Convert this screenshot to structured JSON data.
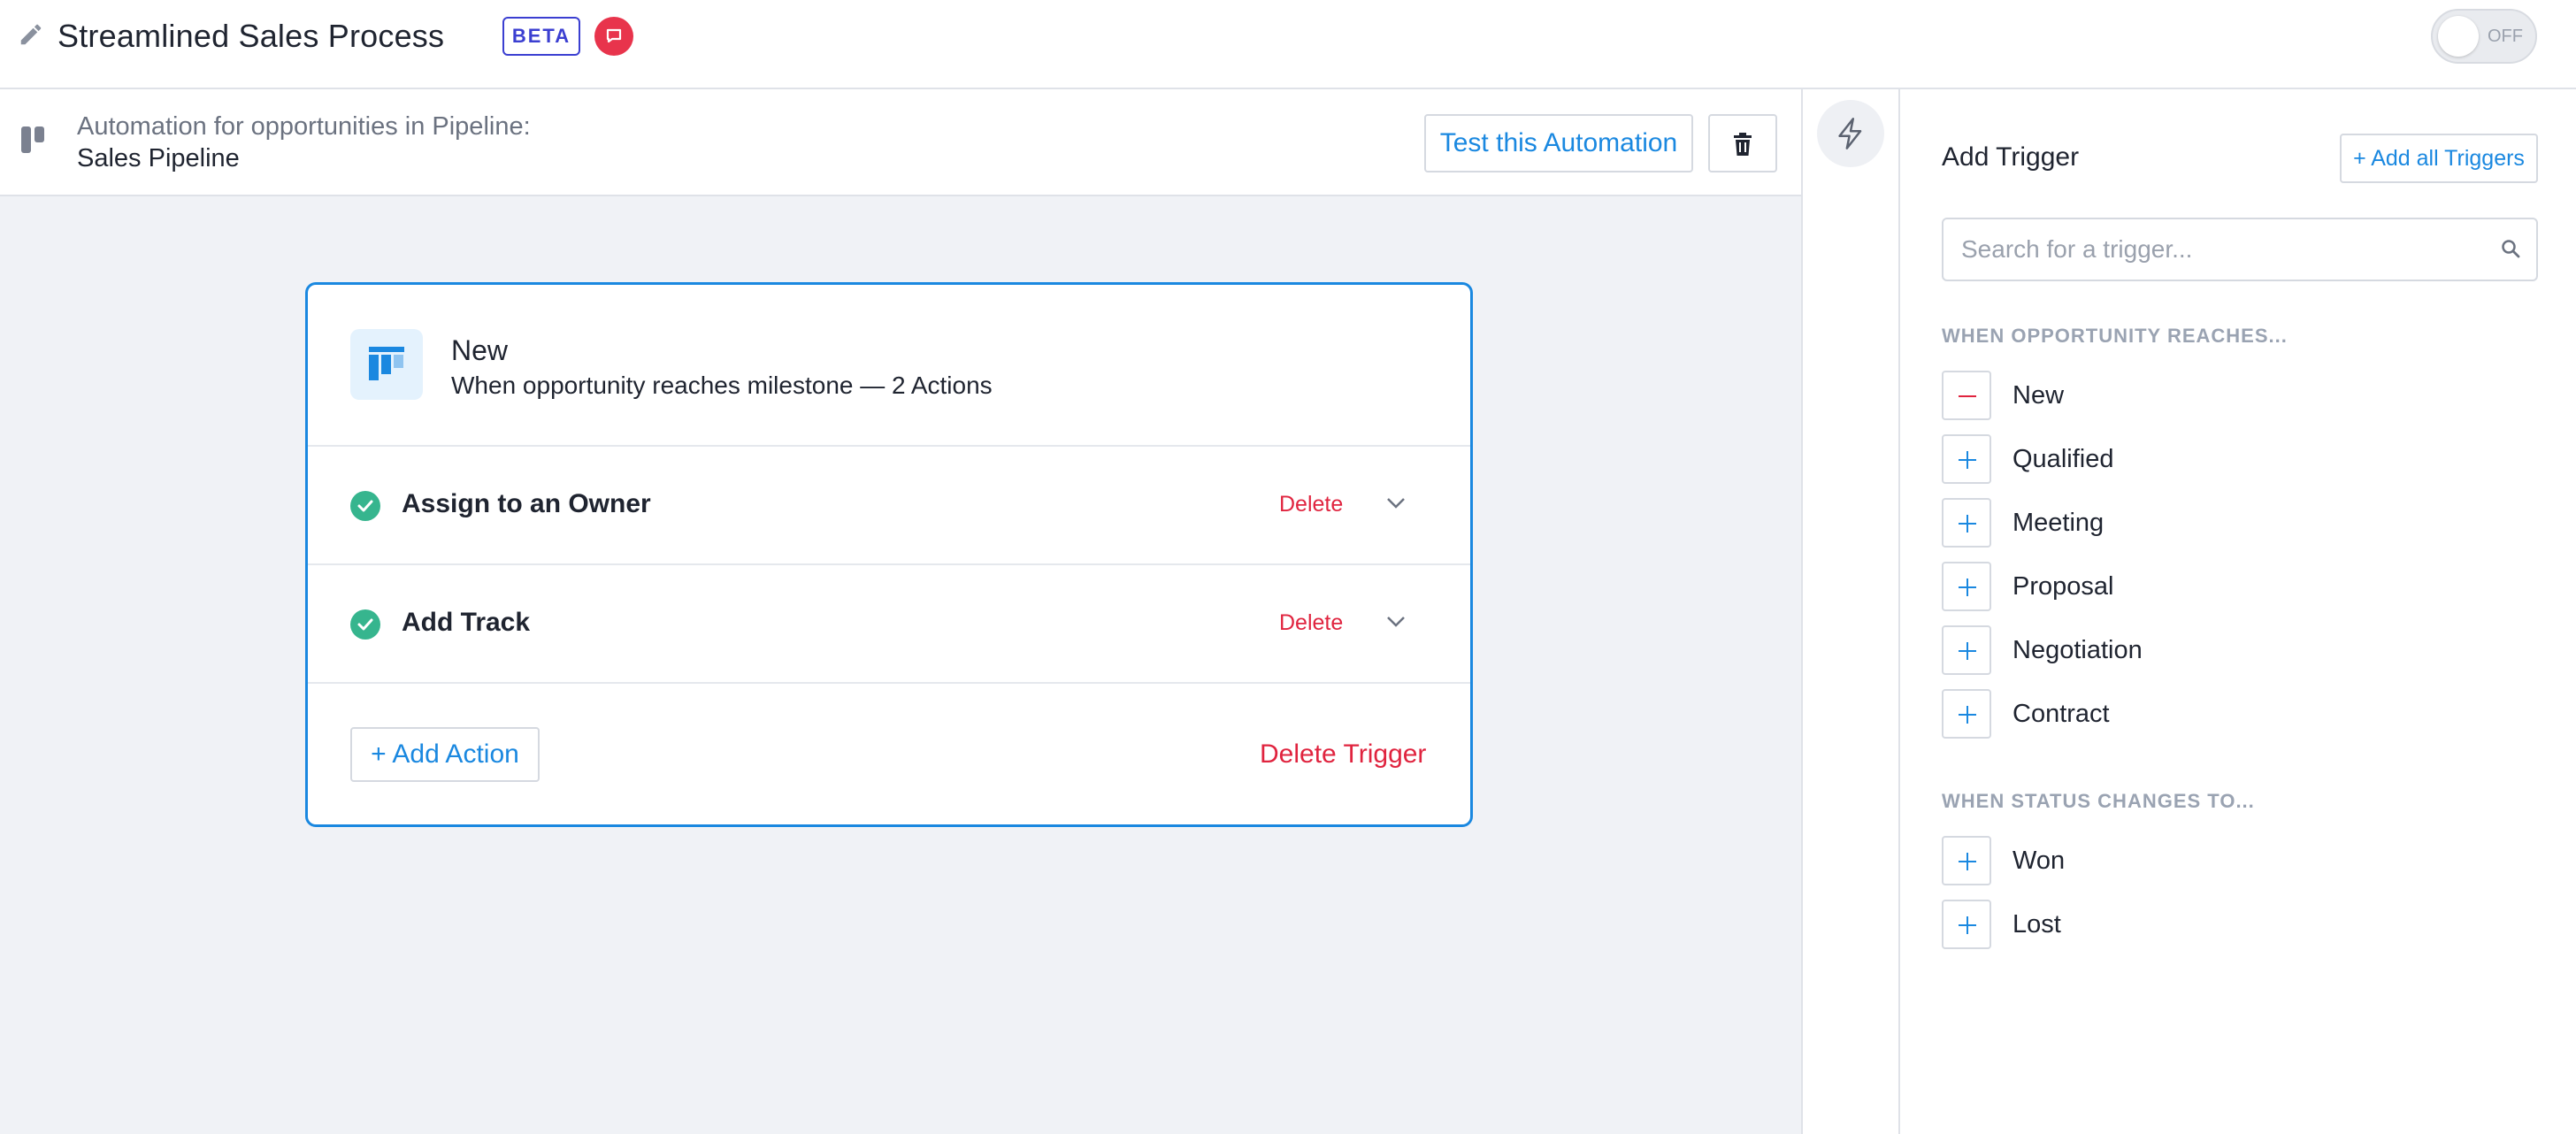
{
  "header": {
    "title": "Streamlined Sales Process",
    "beta_badge": "BETA",
    "toggle_state": "OFF"
  },
  "automation": {
    "context_label": "Automation for opportunities in Pipeline:",
    "pipeline_name": "Sales Pipeline",
    "test_button": "Test this Automation"
  },
  "card": {
    "title": "New",
    "subtitle": "When opportunity reaches milestone — 2 Actions",
    "actions": [
      {
        "label": "Assign to an Owner",
        "delete_label": "Delete"
      },
      {
        "label": "Add Track",
        "delete_label": "Delete"
      }
    ],
    "add_action": "+ Add Action",
    "delete_trigger": "Delete Trigger"
  },
  "panel": {
    "title": "Add Trigger",
    "add_all": "+ Add all Triggers",
    "search_placeholder": "Search for a trigger...",
    "sections": [
      {
        "label": "WHEN OPPORTUNITY REACHES...",
        "items": [
          {
            "label": "New",
            "state": "added"
          },
          {
            "label": "Qualified",
            "state": "available"
          },
          {
            "label": "Meeting",
            "state": "available"
          },
          {
            "label": "Proposal",
            "state": "available"
          },
          {
            "label": "Negotiation",
            "state": "available"
          },
          {
            "label": "Contract",
            "state": "available"
          }
        ]
      },
      {
        "label": "WHEN STATUS CHANGES TO...",
        "items": [
          {
            "label": "Won",
            "state": "available"
          },
          {
            "label": "Lost",
            "state": "available"
          }
        ]
      }
    ]
  },
  "colors": {
    "accent": "#1a88e0",
    "danger": "#e0243f",
    "success": "#36b58e",
    "beta": "#3b3fd1",
    "canvas": "#f0f2f6"
  }
}
